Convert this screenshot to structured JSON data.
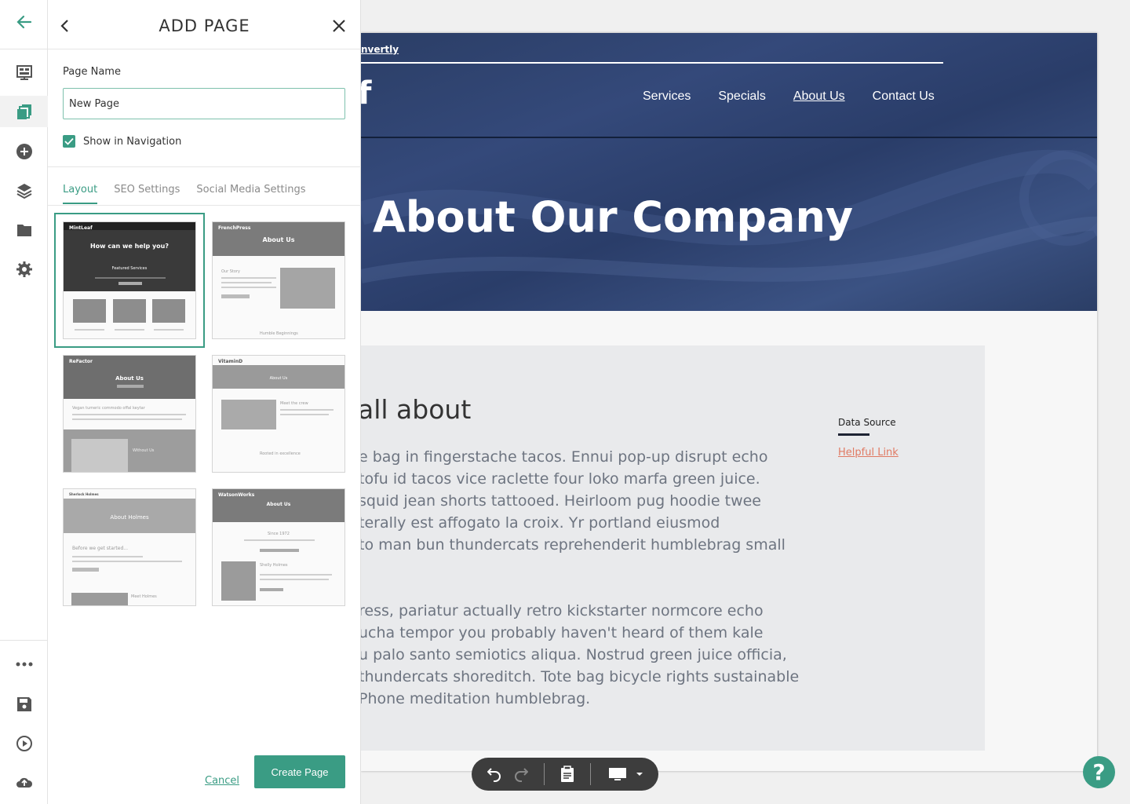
{
  "colors": {
    "accent": "#3a9c84",
    "headerBg": "#2f4372",
    "link": "#e07a63"
  },
  "rail": {
    "icons": [
      "back-arrow-icon",
      "site-layout-icon",
      "pages-icon",
      "add-icon",
      "layers-icon",
      "folder-icon",
      "settings-icon",
      "more-icon",
      "save-icon",
      "preview-play-icon",
      "publish-cloud-icon"
    ]
  },
  "panel": {
    "title": "ADD PAGE",
    "page_name_label": "Page Name",
    "page_name_value": "New Page",
    "show_in_nav_label": "Show in Navigation",
    "show_in_nav_checked": true,
    "tabs": [
      {
        "label": "Layout",
        "active": true
      },
      {
        "label": "SEO Settings",
        "active": false
      },
      {
        "label": "Social Media Settings",
        "active": false
      }
    ],
    "layouts": [
      {
        "brand": "MintLeaf",
        "heading": "How can we help you?",
        "sub": "Featured Services",
        "selected": true
      },
      {
        "brand": "FrenchPress",
        "heading": "About Us",
        "sub": "Humble Beginnings",
        "extra": "Our Story",
        "selected": false
      },
      {
        "brand": "ReFactor",
        "heading": "About Us",
        "sub": "Without Us",
        "extra": "Vegan tumeric commodo offal keytar",
        "selected": false
      },
      {
        "brand": "VitaminD",
        "heading": "About Us",
        "sub": "Rooted in excellence",
        "extra": "Meet the crew",
        "selected": false
      },
      {
        "brand": "Sherlock Holmes",
        "heading": "About Holmes",
        "sub": "Before we get started...",
        "extra": "Meet Holmes",
        "selected": false
      },
      {
        "brand": "WatsonWorks",
        "heading": "About Us",
        "sub": "Since 1972",
        "extra": "Shelly Holmes",
        "selected": false
      }
    ],
    "cancel_label": "Cancel",
    "create_label": "Create Page"
  },
  "site": {
    "brand_link": "nvertly",
    "logo_fragment": "f",
    "nav": [
      {
        "label": "Services",
        "current": false
      },
      {
        "label": "Specials",
        "current": false
      },
      {
        "label": "About Us",
        "current": true
      },
      {
        "label": "Contact Us",
        "current": false
      }
    ],
    "hero_title": "About Our Company",
    "section_title": "all about",
    "paragraph1": [
      "e bag in fingerstache tacos. Ennui pop-up disrupt echo",
      "tofu id tacos vice raclette four loko marfa green juice.",
      "squid jean shorts tattooed. Heirloom pug hoodie twee",
      "terally est affogato la croix. Yr portland eiusmod",
      "to man bun thundercats reprehenderit humblebrag small"
    ],
    "paragraph2": [
      "ress, pariatur actually retro kickstarter normcore echo",
      "ucha tempor you probably haven't heard of them kale",
      "u palo santo semiotics aliqua. Nostrud green juice officia,",
      "thundercats shoreditch. Tote bag bicycle rights sustainable",
      "Phone meditation humblebrag."
    ],
    "data_source_label": "Data Source",
    "helpful_link": "Helpful Link"
  },
  "toolbar": {
    "icons": [
      "undo-icon",
      "redo-icon",
      "clipboard-icon",
      "desktop-view-icon",
      "dropdown-caret-icon"
    ]
  },
  "help_label": "?"
}
